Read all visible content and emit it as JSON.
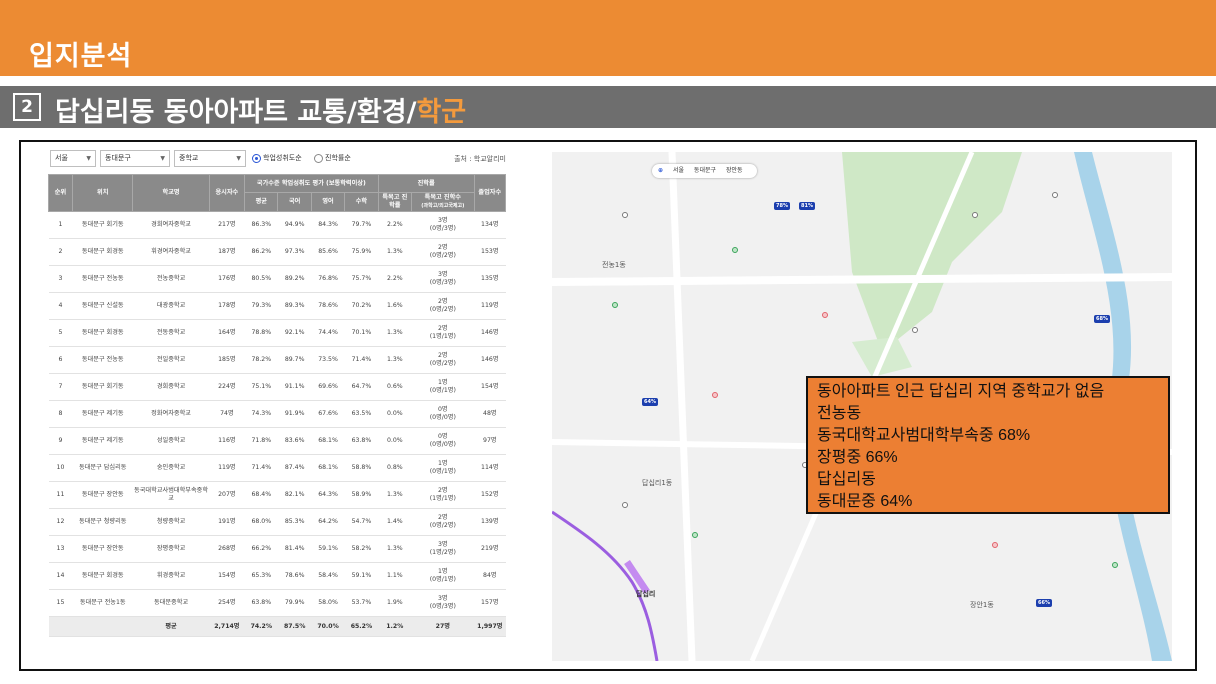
{
  "header": {
    "title": "입지분석",
    "section_number": "2",
    "heading_main": "답십리동 동아아파트 교통/환경/",
    "heading_highlight": "학군"
  },
  "filters": {
    "city": "서울",
    "district": "동대문구",
    "school_type": "중학교",
    "radio_1": "학업성취도순",
    "radio_2": "진학률순",
    "source": "출처 : 학교알리미"
  },
  "table": {
    "headers": {
      "rank": "순위",
      "location": "위치",
      "school": "학교명",
      "takers": "응시자수",
      "group_score": "국가수준 학업성취도 평가 (보통학력이상)",
      "avg": "평균",
      "korean": "국어",
      "english": "영어",
      "math": "수학",
      "group_adv": "진학률",
      "special_rate": "특목고 진학률",
      "special_count": "특목고 진학수",
      "special_count_sub": "(과학고/외고국제고)",
      "grads": "졸업자수"
    },
    "rows": [
      {
        "rank": "1",
        "loc": "동대문구 회기동",
        "school": "경희여자중학교",
        "takers": "217명",
        "avg": "86.3%",
        "kor": "94.9%",
        "eng": "84.3%",
        "math": "79.7%",
        "rate": "2.2%",
        "count": "3명",
        "count_sub": "(0명/3명)",
        "grads": "134명"
      },
      {
        "rank": "2",
        "loc": "동대문구 회경동",
        "school": "휘경여자중학교",
        "takers": "187명",
        "avg": "86.2%",
        "kor": "97.3%",
        "eng": "85.6%",
        "math": "75.9%",
        "rate": "1.3%",
        "count": "2명",
        "count_sub": "(0명/2명)",
        "grads": "153명"
      },
      {
        "rank": "3",
        "loc": "동대문구 전농동",
        "school": "전농중학교",
        "takers": "176명",
        "avg": "80.5%",
        "kor": "89.2%",
        "eng": "76.8%",
        "math": "75.7%",
        "rate": "2.2%",
        "count": "3명",
        "count_sub": "(0명/3명)",
        "grads": "135명"
      },
      {
        "rank": "4",
        "loc": "동대문구 신설동",
        "school": "대광중학교",
        "takers": "178명",
        "avg": "79.3%",
        "kor": "89.3%",
        "eng": "78.6%",
        "math": "70.2%",
        "rate": "1.6%",
        "count": "2명",
        "count_sub": "(0명/2명)",
        "grads": "119명"
      },
      {
        "rank": "5",
        "loc": "동대문구 회경동",
        "school": "전동중학교",
        "takers": "164명",
        "avg": "78.8%",
        "kor": "92.1%",
        "eng": "74.4%",
        "math": "70.1%",
        "rate": "1.3%",
        "count": "2명",
        "count_sub": "(1명/1명)",
        "grads": "146명"
      },
      {
        "rank": "6",
        "loc": "동대문구 전농동",
        "school": "전일중학교",
        "takers": "185명",
        "avg": "78.2%",
        "kor": "89.7%",
        "eng": "73.5%",
        "math": "71.4%",
        "rate": "1.3%",
        "count": "2명",
        "count_sub": "(0명/2명)",
        "grads": "146명"
      },
      {
        "rank": "7",
        "loc": "동대문구 회기동",
        "school": "경희중학교",
        "takers": "224명",
        "avg": "75.1%",
        "kor": "91.1%",
        "eng": "69.6%",
        "math": "64.7%",
        "rate": "0.6%",
        "count": "1명",
        "count_sub": "(0명/1명)",
        "grads": "154명"
      },
      {
        "rank": "8",
        "loc": "동대문구 제기동",
        "school": "정화여자중학교",
        "takers": "74명",
        "avg": "74.3%",
        "kor": "91.9%",
        "eng": "67.6%",
        "math": "63.5%",
        "rate": "0.0%",
        "count": "0명",
        "count_sub": "(0명/0명)",
        "grads": "48명"
      },
      {
        "rank": "9",
        "loc": "동대문구 제기동",
        "school": "성일중학교",
        "takers": "116명",
        "avg": "71.8%",
        "kor": "83.6%",
        "eng": "68.1%",
        "math": "63.8%",
        "rate": "0.0%",
        "count": "0명",
        "count_sub": "(0명/0명)",
        "grads": "97명"
      },
      {
        "rank": "10",
        "loc": "동대문구 답십리동",
        "school": "숭인중학교",
        "takers": "119명",
        "avg": "71.4%",
        "kor": "87.4%",
        "eng": "68.1%",
        "math": "58.8%",
        "rate": "0.8%",
        "count": "1명",
        "count_sub": "(0명/1명)",
        "grads": "114명"
      },
      {
        "rank": "11",
        "loc": "동대문구 장안동",
        "school": "동국대학교사범대학부속중학교",
        "takers": "207명",
        "avg": "68.4%",
        "kor": "82.1%",
        "eng": "64.3%",
        "math": "58.9%",
        "rate": "1.3%",
        "count": "2명",
        "count_sub": "(1명/1명)",
        "grads": "152명"
      },
      {
        "rank": "12",
        "loc": "동대문구 청량리동",
        "school": "청량중학교",
        "takers": "191명",
        "avg": "68.0%",
        "kor": "85.3%",
        "eng": "64.2%",
        "math": "54.7%",
        "rate": "1.4%",
        "count": "2명",
        "count_sub": "(0명/2명)",
        "grads": "139명"
      },
      {
        "rank": "13",
        "loc": "동대문구 장안동",
        "school": "장평중학교",
        "takers": "268명",
        "avg": "66.2%",
        "kor": "81.4%",
        "eng": "59.1%",
        "math": "58.2%",
        "rate": "1.3%",
        "count": "3명",
        "count_sub": "(1명/2명)",
        "grads": "219명"
      },
      {
        "rank": "14",
        "loc": "동대문구 회경동",
        "school": "휘경중학교",
        "takers": "154명",
        "avg": "65.3%",
        "kor": "78.6%",
        "eng": "58.4%",
        "math": "59.1%",
        "rate": "1.1%",
        "count": "1명",
        "count_sub": "(0명/1명)",
        "grads": "84명"
      },
      {
        "rank": "15",
        "loc": "동대문구 전농1동",
        "school": "동대문중학교",
        "takers": "254명",
        "avg": "63.8%",
        "kor": "79.9%",
        "eng": "58.0%",
        "math": "53.7%",
        "rate": "1.9%",
        "count": "3명",
        "count_sub": "(0명/3명)",
        "grads": "157명"
      }
    ],
    "total": {
      "label": "평균",
      "takers": "2,714명",
      "avg": "74.2%",
      "kor": "87.5%",
      "eng": "70.0%",
      "math": "65.2%",
      "rate": "1.2%",
      "count": "27명",
      "grads": "1,997명"
    }
  },
  "map": {
    "control": {
      "region_1": "서울",
      "region_2": "동대문구",
      "region_3": "장안동"
    },
    "labels": {
      "a": "전농1동",
      "b": "답십리1동",
      "c": "장안1동",
      "d": "답십리"
    },
    "pins": {
      "p1": "78%",
      "p2": "81%",
      "p3": "64%",
      "p4": "68%",
      "p5": "66%"
    }
  },
  "callout": {
    "line1": "동아아파트 인근 답십리 지역 중학교가 없음",
    "line2": "전농동",
    "line3": "동국대학교사범대학부속중 68%",
    "line4": "장평중 66%",
    "line5": "답십리동",
    "line6": "동대문중 64%"
  }
}
